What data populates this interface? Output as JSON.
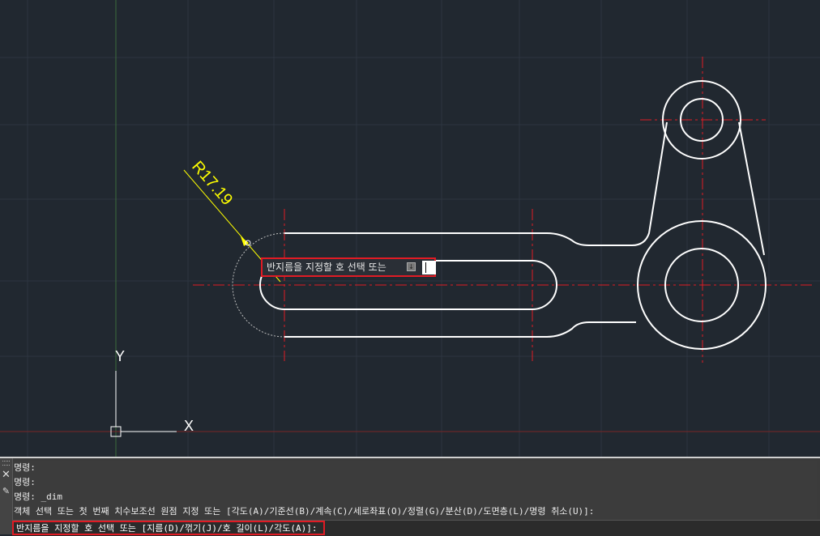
{
  "drawing": {
    "dimension_text": "R17.19",
    "dynamic_prompt": "반지름을 지정할 호 선택 또는",
    "dynamic_input_value": "",
    "ucs_y_label": "Y",
    "ucs_x_label": "X",
    "colors": {
      "background": "#212830",
      "geometry": "#ffffff",
      "centerlines": "#e01b24",
      "dimension": "#ffff00",
      "grid": "#2d3540"
    }
  },
  "command_window": {
    "history": [
      "명령:",
      "명령:",
      "명령: _dim",
      "객체 선택 또는 첫 번째 치수보조선 원점 지정 또는 [각도(A)/기준선(B)/계속(C)/세로좌표(O)/정렬(G)/분산(D)/도면층(L)/명령 취소(U)]:"
    ],
    "current_prompt": "반지름을 지정할 호 선택 또는 [지름(D)/꺾기(J)/호 길이(L)/각도(A)]:",
    "icons": [
      "close-icon",
      "customize-icon"
    ]
  }
}
